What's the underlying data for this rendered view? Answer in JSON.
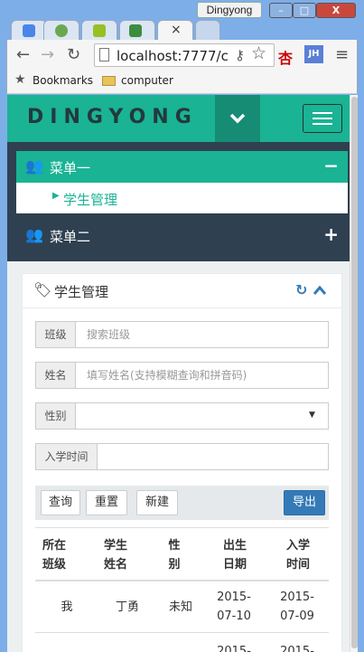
{
  "window": {
    "title": "Dingyong",
    "min": "–",
    "max": "□",
    "close": "X"
  },
  "browser": {
    "url": "localhost:7777/c",
    "bookmarks": [
      "Bookmarks",
      "computer"
    ]
  },
  "app": {
    "logo": "DINGYONG",
    "menus": [
      {
        "label": "菜单一",
        "toggle": "−",
        "items": [
          {
            "label": "学生管理"
          }
        ]
      },
      {
        "label": "菜单二",
        "toggle": "+"
      }
    ]
  },
  "panel": {
    "title": "学生管理",
    "fields": [
      {
        "label": "班级",
        "placeholder": "搜索班级"
      },
      {
        "label": "姓名",
        "placeholder": "填写姓名(支持模糊查询和拼音码)"
      },
      {
        "label": "性别",
        "placeholder": ""
      },
      {
        "label": "入学时间",
        "placeholder": ""
      }
    ],
    "buttons": {
      "query": "查询",
      "reset": "重置",
      "create": "新建",
      "export": "导出"
    },
    "table": {
      "headers": [
        [
          "所在",
          "班级"
        ],
        [
          "学生",
          "姓名"
        ],
        [
          "性",
          "别"
        ],
        [
          "出生",
          "日期"
        ],
        [
          "入学",
          "时间"
        ]
      ],
      "rows": [
        {
          "class": "我",
          "name": "丁勇",
          "gender": "未知",
          "birth": [
            "2015-",
            "07-10"
          ],
          "enroll": [
            "2015-",
            "07-09"
          ]
        },
        {
          "class": "",
          "name": "",
          "gender": "",
          "birth": [
            "2015-",
            ""
          ],
          "enroll": [
            "2015-",
            ""
          ]
        }
      ]
    }
  },
  "colors": {
    "brand": "#1ab394",
    "nav_dark": "#2f4050",
    "export": "#337ab7"
  }
}
